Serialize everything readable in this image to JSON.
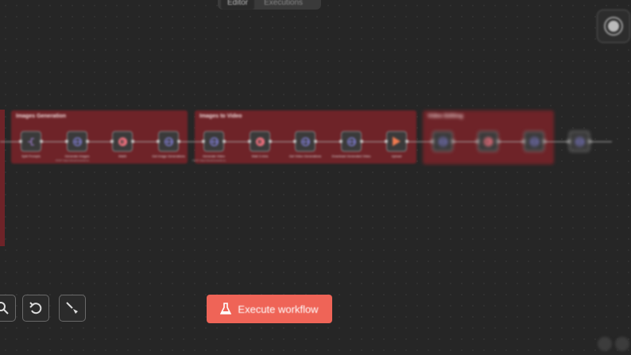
{
  "tabs": [
    {
      "label": "Editor",
      "active": true
    },
    {
      "label": "Executions",
      "active": false
    }
  ],
  "groups": [
    {
      "title": "Images Generation"
    },
    {
      "title": "Images to Video"
    },
    {
      "title": "Video Editing"
    }
  ],
  "nodes": [
    {
      "label": "Split Prompts",
      "icon": "split-icon"
    },
    {
      "label": "Generate Images",
      "sub": "POST: https://cloud.leonardo.ai...",
      "icon": "globe-icon"
    },
    {
      "label": "Wait3",
      "icon": "pause-icon"
    },
    {
      "label": "Get Image Generations",
      "icon": "globe-icon"
    },
    {
      "label": "Generate Video",
      "sub": "POST: https://cloud.leonardo.ai...",
      "icon": "globe-icon"
    },
    {
      "label": "Wait 3 mins",
      "icon": "pause-icon"
    },
    {
      "label": "Get Video Generations",
      "icon": "globe-icon"
    },
    {
      "label": "Download Generated Video",
      "icon": "globe-icon"
    },
    {
      "label": "Upload",
      "icon": "play-icon"
    },
    {
      "label": "",
      "icon": "globe-icon"
    },
    {
      "label": "",
      "icon": "pause-icon"
    },
    {
      "label": "",
      "icon": "globe-icon"
    },
    {
      "label": "",
      "icon": "globe-icon"
    }
  ],
  "toolbar": {
    "execute_label": "Execute workflow",
    "icons": [
      "zoom-icon",
      "undo-icon",
      "clear-execution-icon"
    ]
  },
  "colors": {
    "background": "#262626",
    "group": "#6e2328",
    "execute_button": "#ef6457",
    "http_icon": "#8a86e8",
    "wait_icon": "#f0707e"
  }
}
